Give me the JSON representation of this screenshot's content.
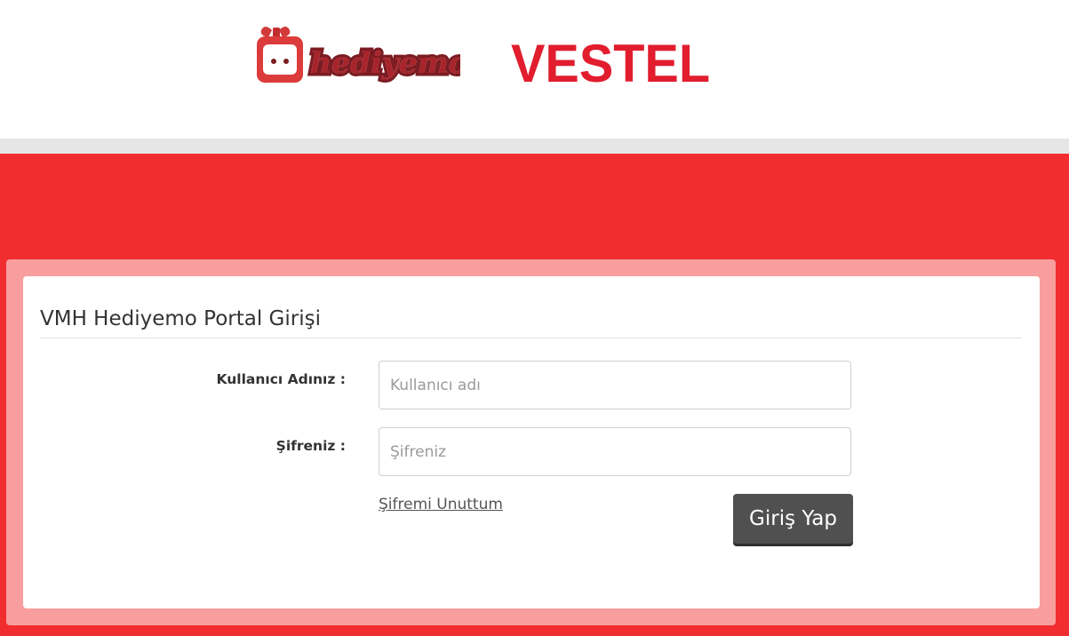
{
  "header": {
    "logos": {
      "hediyemo": {
        "text": "hediyemo",
        "icon": "gift-box-face-icon",
        "color": "#a8232a"
      },
      "vestel": {
        "text": "VESTEL",
        "color": "#e11d2e"
      }
    }
  },
  "colors": {
    "band_gray": "#e6e6e6",
    "band_red": "#f12d30",
    "card_border": "#f99e9e",
    "button": "#505050"
  },
  "login": {
    "title": "VMH Hediyemo Portal Girişi",
    "username_label": "Kullanıcı Adınız :",
    "username_placeholder": "Kullanıcı adı",
    "username_value": "",
    "password_label": "Şifreniz :",
    "password_placeholder": "Şifreniz",
    "password_value": "",
    "forgot_link": "Şifremi Unuttum",
    "submit_label": "Giriş Yap"
  }
}
